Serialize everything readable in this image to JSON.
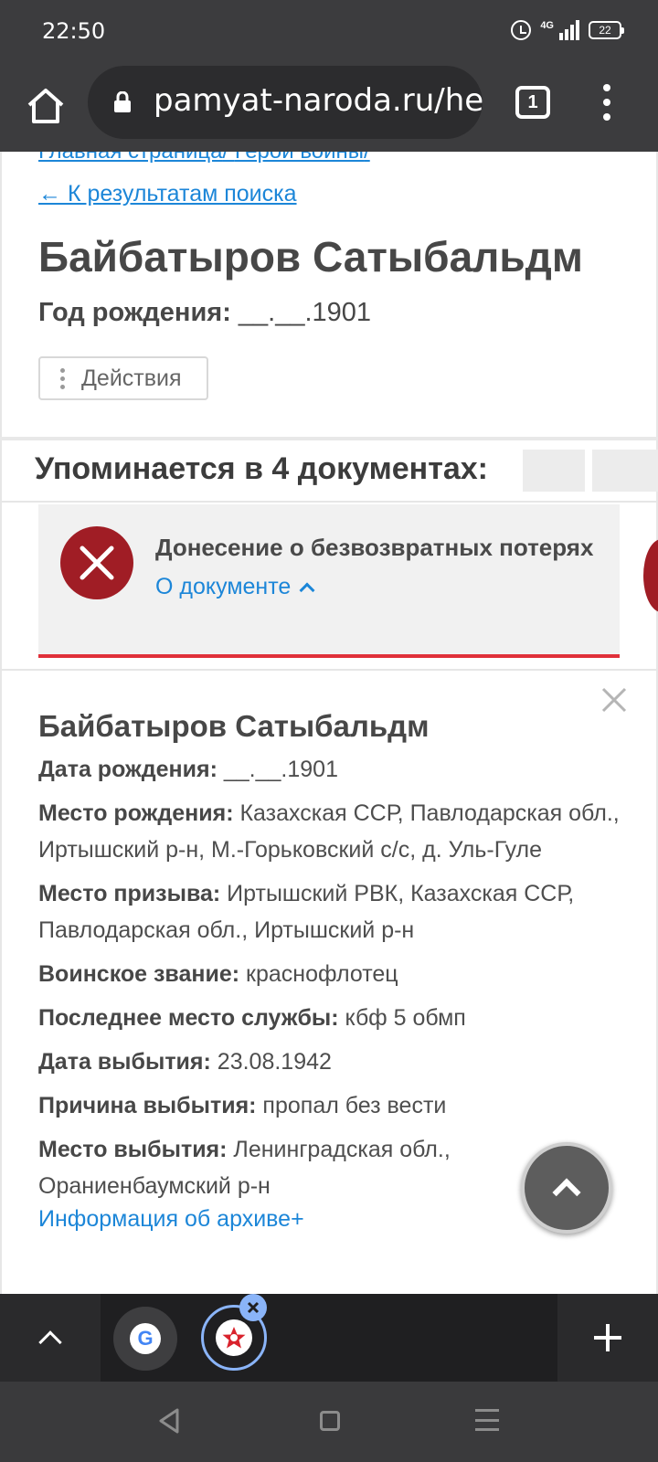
{
  "status_bar": {
    "time": "22:50",
    "network": "4G",
    "battery": "22",
    "icons": [
      "alarm-icon",
      "signal-icon",
      "battery-icon"
    ]
  },
  "browser": {
    "url": "pamyat-naroda.ru/he",
    "tab_count": "1",
    "icons": [
      "home-icon",
      "lock-icon",
      "tab-switcher-icon",
      "more-menu-icon"
    ]
  },
  "page": {
    "breadcrumb": [
      "Главная страница",
      "/ ",
      "Герои войны",
      "/"
    ],
    "back_link": "← К результатам поиска",
    "person_name": "Байбатыров Сатыбальдм",
    "birth_label": "Год рождения:",
    "birth_value": " __.__.1901",
    "actions_label": "Действия",
    "mentions_title": "Упоминается в 4 документах:",
    "document": {
      "type": "Донесение о безвозвратных потерях",
      "about_link": "О документе",
      "accent_color": "#a01d25"
    },
    "detail": {
      "name": "Байбатыров Сатыбальдм",
      "fields": [
        {
          "label": "Дата рождения:",
          "value": " __.__.1901"
        },
        {
          "label": "Место рождения:",
          "value": " Казахская ССР, Павлодарская обл., Иртышский р-н, М.-Горьковский с/с, д. Уль-Гуле"
        },
        {
          "label": "Место призыва:",
          "value": " Иртышский РВК, Казахская ССР, Павлодарская обл., Иртышский р-н"
        },
        {
          "label": "Воинское звание:",
          "value": " краснофлотец"
        },
        {
          "label": "Последнее место службы:",
          "value": " кбф 5 обмп"
        },
        {
          "label": "Дата выбытия:",
          "value": " 23.08.1942"
        },
        {
          "label": "Причина выбытия:",
          "value": " пропал без вести"
        },
        {
          "label": "Место выбытия:",
          "value": " Ленинградская обл., Ораниенбаумский р-н"
        }
      ],
      "archive_link": "Информация об архиве+"
    },
    "link_color": "#1c86d8"
  },
  "tab_strip": {
    "icons": [
      "chevron-up-icon",
      "google-tab-icon",
      "star-tab-icon",
      "close-tab-icon",
      "plus-icon"
    ],
    "google_letter": "G"
  },
  "nav_bar": {
    "icons": [
      "back-icon",
      "home-icon",
      "recents-icon"
    ]
  }
}
